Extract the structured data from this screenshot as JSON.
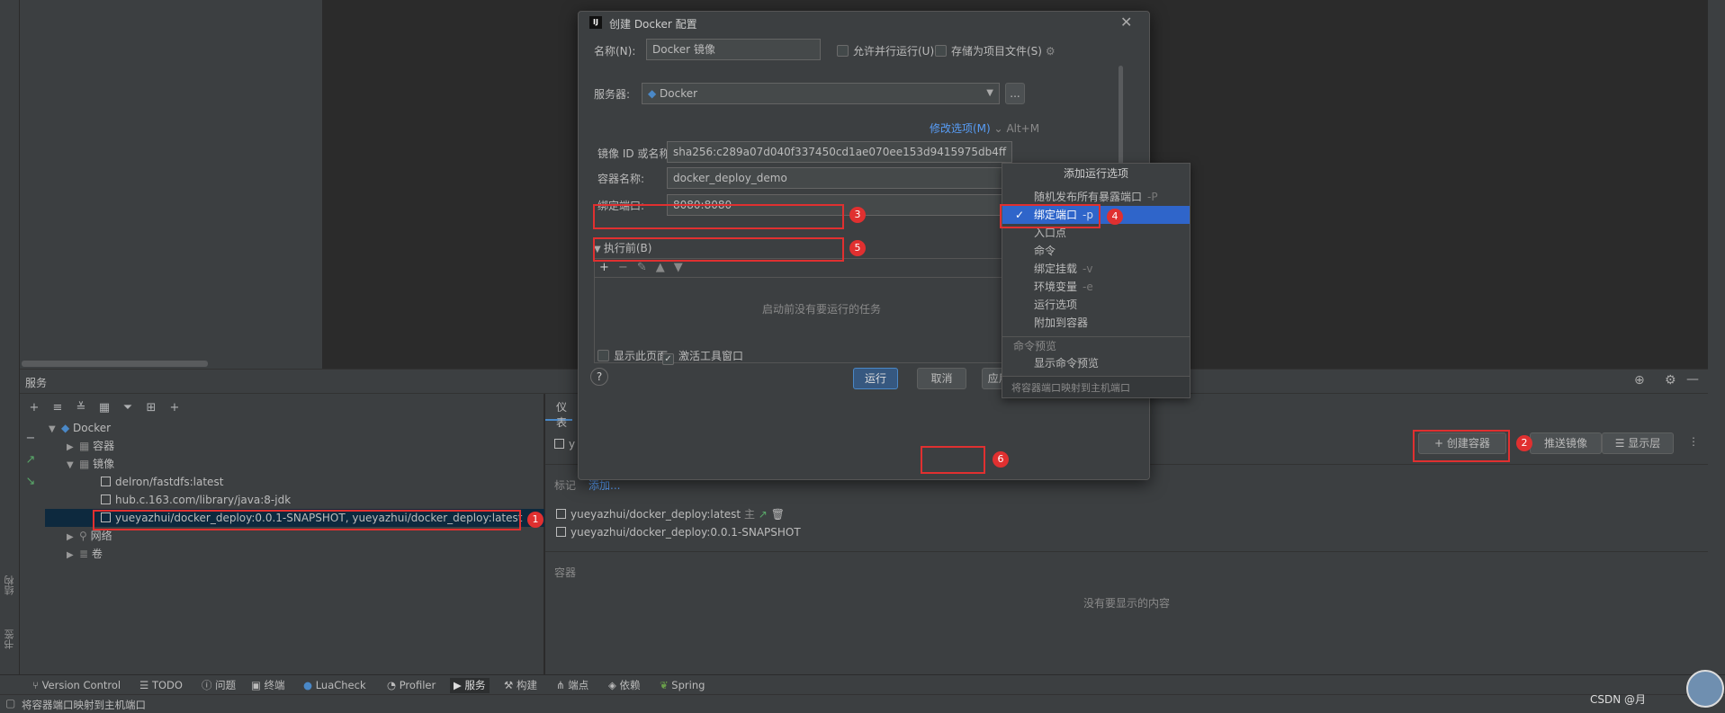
{
  "colors": {
    "accent": "#4a88c7",
    "select": "#2f65ca",
    "marker": "#e03030"
  },
  "services_panel": {
    "title": "服务",
    "tree": {
      "root": "Docker",
      "containers": "容器",
      "images": "镜像",
      "image_items": [
        "delron/fastdfs:latest",
        "hub.c.163.com/library/java:8-jdk",
        "yueyazhui/docker_deploy:0.0.1-SNAPSHOT, yueyazhui/docker_deploy:latest"
      ],
      "networks": "网络",
      "volumes": "卷"
    }
  },
  "right_panel": {
    "tab": "仪表",
    "header_prefix": "y",
    "tag_label": "标记",
    "add_link": "添加...",
    "create_container": "创建容器",
    "push_image": "推送镜像",
    "show_layers": "显示层",
    "tags": [
      "yueyazhui/docker_deploy:latest",
      "yueyazhui/docker_deploy:0.0.1-SNAPSHOT"
    ],
    "tag_star": "主",
    "containers_label": "容器",
    "no_content": "没有要显示的内容"
  },
  "dialog": {
    "title": "创建 Docker 配置",
    "name_label": "名称(N):",
    "name_value": "Docker 镜像",
    "allow_parallel": "允许并行运行(U)",
    "store_as_file": "存储为项目文件(S)",
    "server_label": "服务器:",
    "server_value": "Docker",
    "more_button": "...",
    "modify_options": "修改选项(M)",
    "modify_shortcut": "Alt+M",
    "image_label": "镜像 ID 或名称:",
    "image_value": "sha256:c289a07d040f337450cd1ae070ee153d9415975db4ff",
    "container_label": "容器名称:",
    "container_value": "docker_deploy_demo",
    "bind_label": "绑定端口:",
    "bind_value": "8080:8080",
    "before_launch": "执行前(B)",
    "no_tasks": "启动前没有要运行的任务",
    "show_page": "显示此页面",
    "activate_tool": "激活工具窗口",
    "help": "?",
    "run": "运行",
    "cancel": "取消",
    "apply": "应用(A)"
  },
  "popup": {
    "title": "添加运行选项",
    "items": [
      {
        "label": "随机发布所有暴露端口",
        "hint": "-P"
      },
      {
        "label": "绑定端口",
        "hint": "-p"
      },
      {
        "label": "入口点",
        "hint": ""
      },
      {
        "label": "命令",
        "hint": ""
      },
      {
        "label": "绑定挂载",
        "hint": "-v"
      },
      {
        "label": "环境变量",
        "hint": "-e"
      },
      {
        "label": "运行选项",
        "hint": ""
      },
      {
        "label": "附加到容器",
        "hint": ""
      }
    ],
    "section": "命令预览",
    "preview_item": "显示命令预览",
    "footer": "将容器端口映射到主机端口"
  },
  "markers": [
    "1",
    "2",
    "3",
    "4",
    "5",
    "6"
  ],
  "bottom_tabs": [
    "Version Control",
    "TODO",
    "问题",
    "终端",
    "LuaCheck",
    "Profiler",
    "服务",
    "构建",
    "端点",
    "依赖",
    "Spring"
  ],
  "status_text": "将容器端口映射到主机端口",
  "side_labels": {
    "structure": "结构",
    "bookmarks": "书签"
  },
  "watermark": "CSDN @月"
}
